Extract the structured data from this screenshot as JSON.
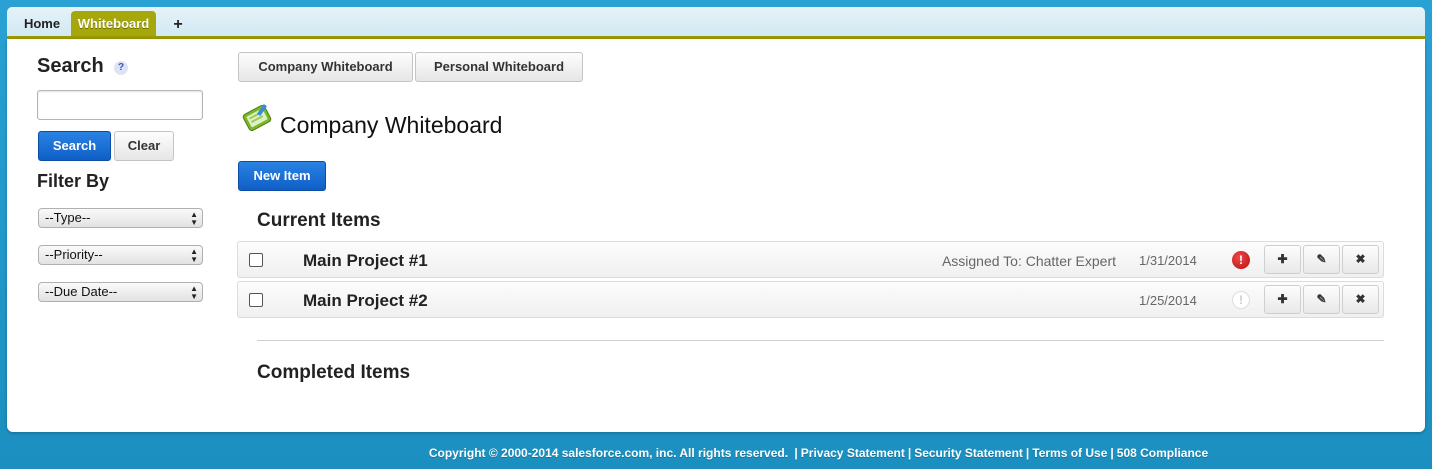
{
  "tabs": {
    "home": "Home",
    "whiteboard": "Whiteboard",
    "add": "+"
  },
  "sidebar": {
    "search_title": "Search",
    "help": "?",
    "search_value": "",
    "search_button": "Search",
    "clear_button": "Clear",
    "filter_title": "Filter By",
    "filters": [
      "--Type--",
      "--Priority--",
      "--Due Date--"
    ]
  },
  "main": {
    "company_button": "Company Whiteboard",
    "personal_button": "Personal Whiteboard",
    "board_title": "Company Whiteboard",
    "new_item_button": "New Item",
    "current_title": "Current Items",
    "completed_title": "Completed Items",
    "items": [
      {
        "name": "Main Project #1",
        "assigned": "Assigned To: Chatter Expert",
        "date": "1/31/2014",
        "priority": "high"
      },
      {
        "name": "Main Project #2",
        "assigned": "",
        "date": "1/25/2014",
        "priority": "none"
      }
    ],
    "actions": {
      "add": "✚",
      "edit": "✎",
      "delete": "✖"
    },
    "priority_glyph": "!"
  },
  "footer": {
    "copyright": "Copyright © 2000-2014 salesforce.com, inc. All rights reserved.",
    "sep": "|",
    "links": [
      "Privacy Statement",
      "Security Statement",
      "Terms of Use",
      "508 Compliance"
    ]
  },
  "colors": {
    "accent_tab": "#a6a70a",
    "primary_button": "#0f5fc6",
    "background": "#1f97c9",
    "priority_high": "#cc1a1a"
  },
  "icons": {
    "board": "whiteboard-tablet-icon",
    "help": "help-icon",
    "priority_high": "priority-high-icon",
    "priority_none": "priority-none-icon",
    "add": "plus-icon",
    "edit": "pencil-icon",
    "delete": "close-icon"
  }
}
